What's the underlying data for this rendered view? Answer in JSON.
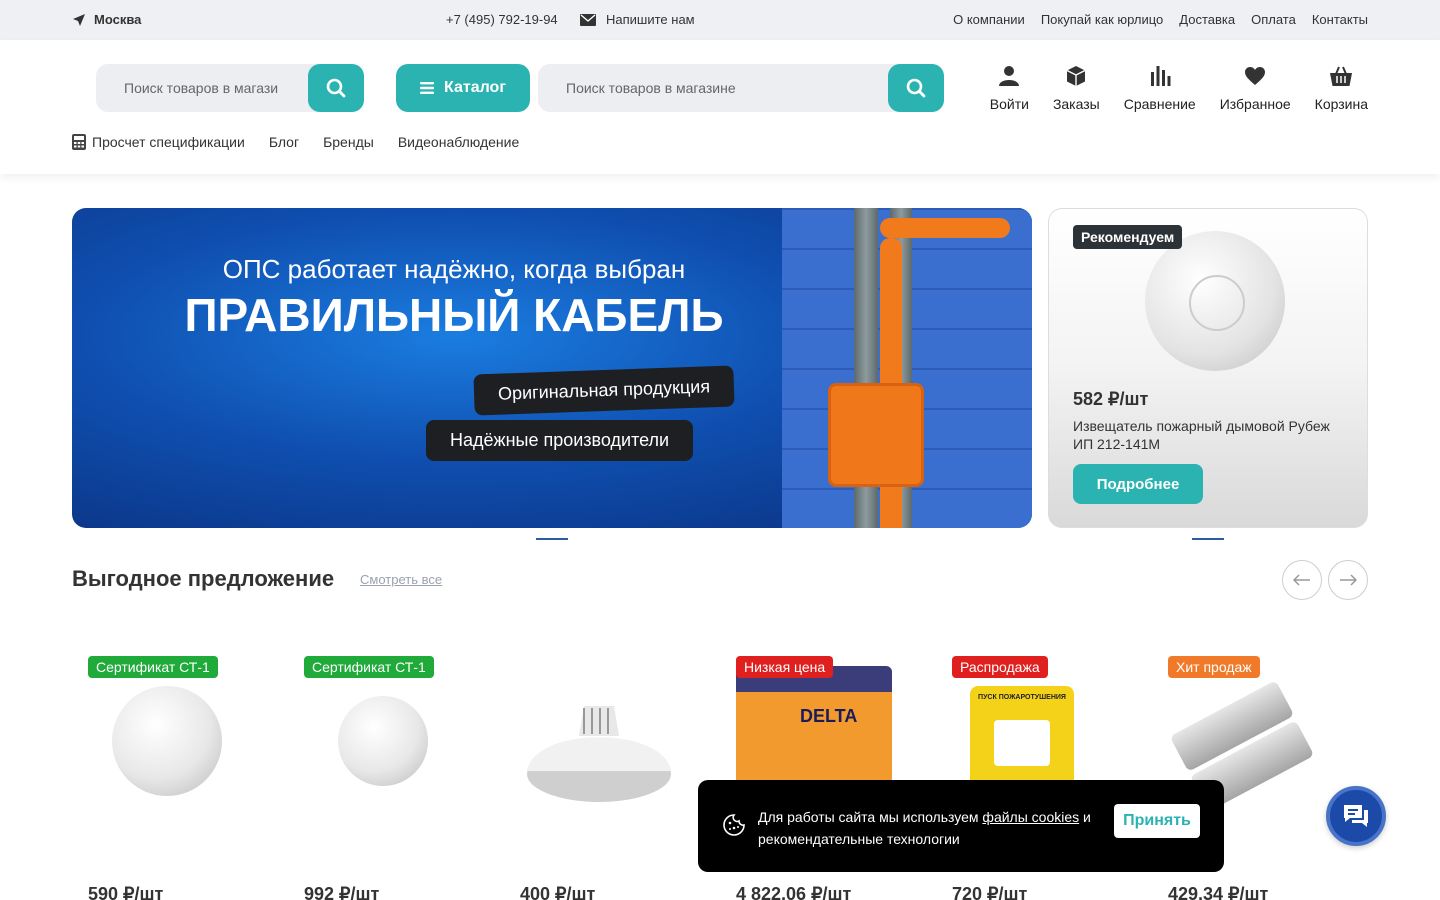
{
  "topbar": {
    "city": "Москва",
    "phone": "+7 (495) 792-19-94",
    "mail": "Напишите нам",
    "links": [
      "О компании",
      "Покупай как юрлицо",
      "Доставка",
      "Оплата",
      "Контакты"
    ]
  },
  "header": {
    "search_small_placeholder": "Поиск товаров в магази",
    "catalog_label": "Каталог",
    "search_main_placeholder": "Поиск товаров в магазине",
    "icons": [
      "Войти",
      "Заказы",
      "Сравнение",
      "Избранное",
      "Корзина"
    ],
    "subnav": [
      "Просчет спецификации",
      "Блог",
      "Бренды",
      "Видеонаблюдение"
    ]
  },
  "banner": {
    "line1": "ОПС работает надёжно, когда выбран",
    "line2": "ПРАВИЛЬНЫЙ КАБЕЛЬ",
    "tag1": "Оригинальная продукция",
    "tag2": "Надёжные производители"
  },
  "recommend": {
    "badge": "Рекомендуем",
    "price": "582 ₽/шт",
    "name": "Извещатель пожарный дымовой Рубеж ИП 212-141М",
    "button": "Подробнее"
  },
  "offers": {
    "title": "Выгодное предложение",
    "see_all": "Смотреть все",
    "products": [
      {
        "tag": "Сертификат СТ-1",
        "tag_color": "#1faa3a",
        "price": "590 ₽/шт"
      },
      {
        "tag": "Сертификат СТ-1",
        "tag_color": "#1faa3a",
        "price": "992 ₽/шт"
      },
      {
        "tag": "",
        "tag_color": "",
        "price": "400 ₽/шт"
      },
      {
        "tag": "Низкая цена",
        "tag_color": "#e01f1f",
        "price": "4 822,06 ₽/шт"
      },
      {
        "tag": "Распродажа",
        "tag_color": "#e01f1f",
        "price": "720 ₽/шт"
      },
      {
        "tag": "Хит продаж",
        "tag_color": "#f07a2a",
        "price": "429,34 ₽/шт"
      }
    ]
  },
  "battery_logo": "DELTA",
  "mcp_label": "ПУСК ПОЖАРОТУШЕНИЯ",
  "cookie": {
    "text_before": "Для работы сайта мы используем ",
    "link": "файлы cookies",
    "text_after": " и рекомендательные технологии",
    "accept": "Принять"
  },
  "colors": {
    "accent": "#2ab3b1",
    "topbar_bg": "#eef0f3",
    "chat": "#1c4aa8"
  }
}
